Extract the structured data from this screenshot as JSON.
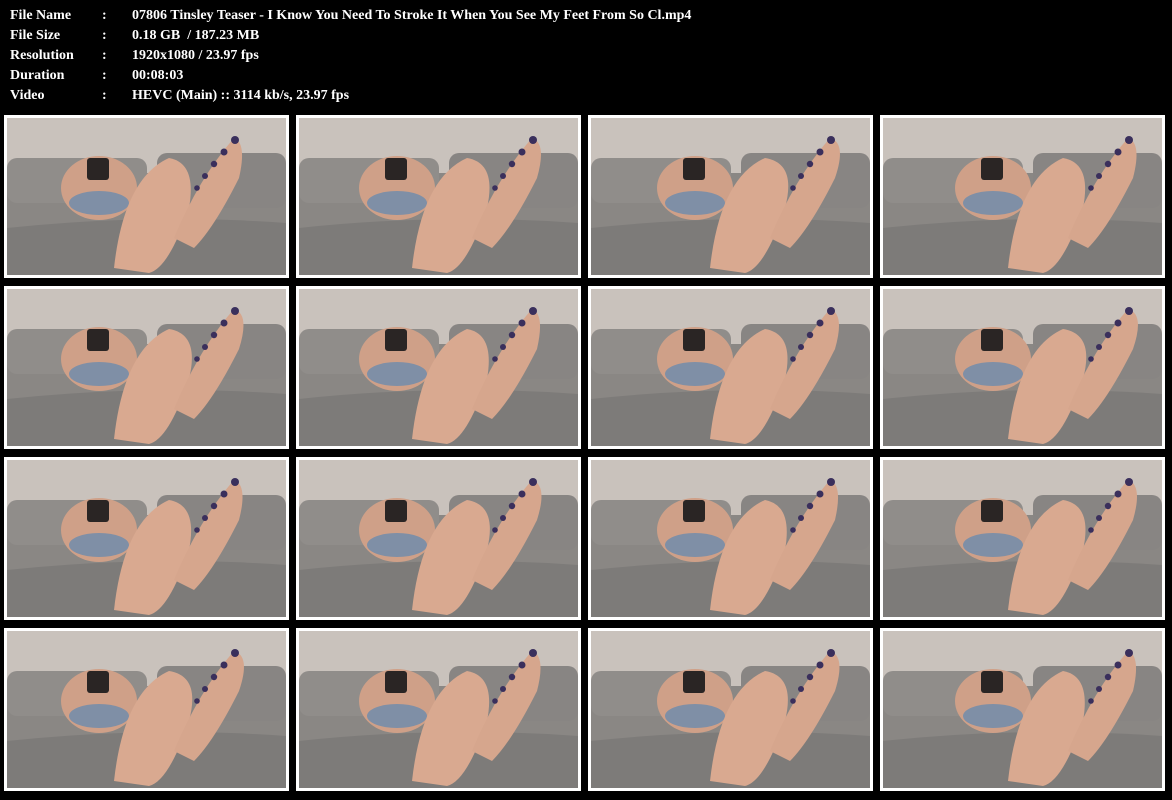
{
  "info": {
    "rows": [
      {
        "key": "File Name",
        "sep": ":",
        "value": "07806 Tinsley Teaser - I Know You Need To Stroke It When You See My Feet From So Cl.mp4"
      },
      {
        "key": "File Size",
        "sep": ":",
        "value": "0.18 GB  / 187.23 MB"
      },
      {
        "key": "Resolution",
        "sep": ":",
        "value": "1920x1080 / 23.97 fps"
      },
      {
        "key": "Duration",
        "sep": ":",
        "value": "00:08:03"
      },
      {
        "key": "Video",
        "sep": ":",
        "value": "HEVC (Main) :: 3114 kb/s, 23.97 fps"
      }
    ]
  },
  "thumbnails": {
    "count": 16,
    "columns": 4,
    "rows": 4
  },
  "colors": {
    "background": "#000000",
    "text": "#ffffff",
    "thumb_border": "#ffffff",
    "wall": "#c9c2bc",
    "sofa": "#7d7b79",
    "skin": "#d9a990",
    "toenail": "#3a2f5c"
  }
}
